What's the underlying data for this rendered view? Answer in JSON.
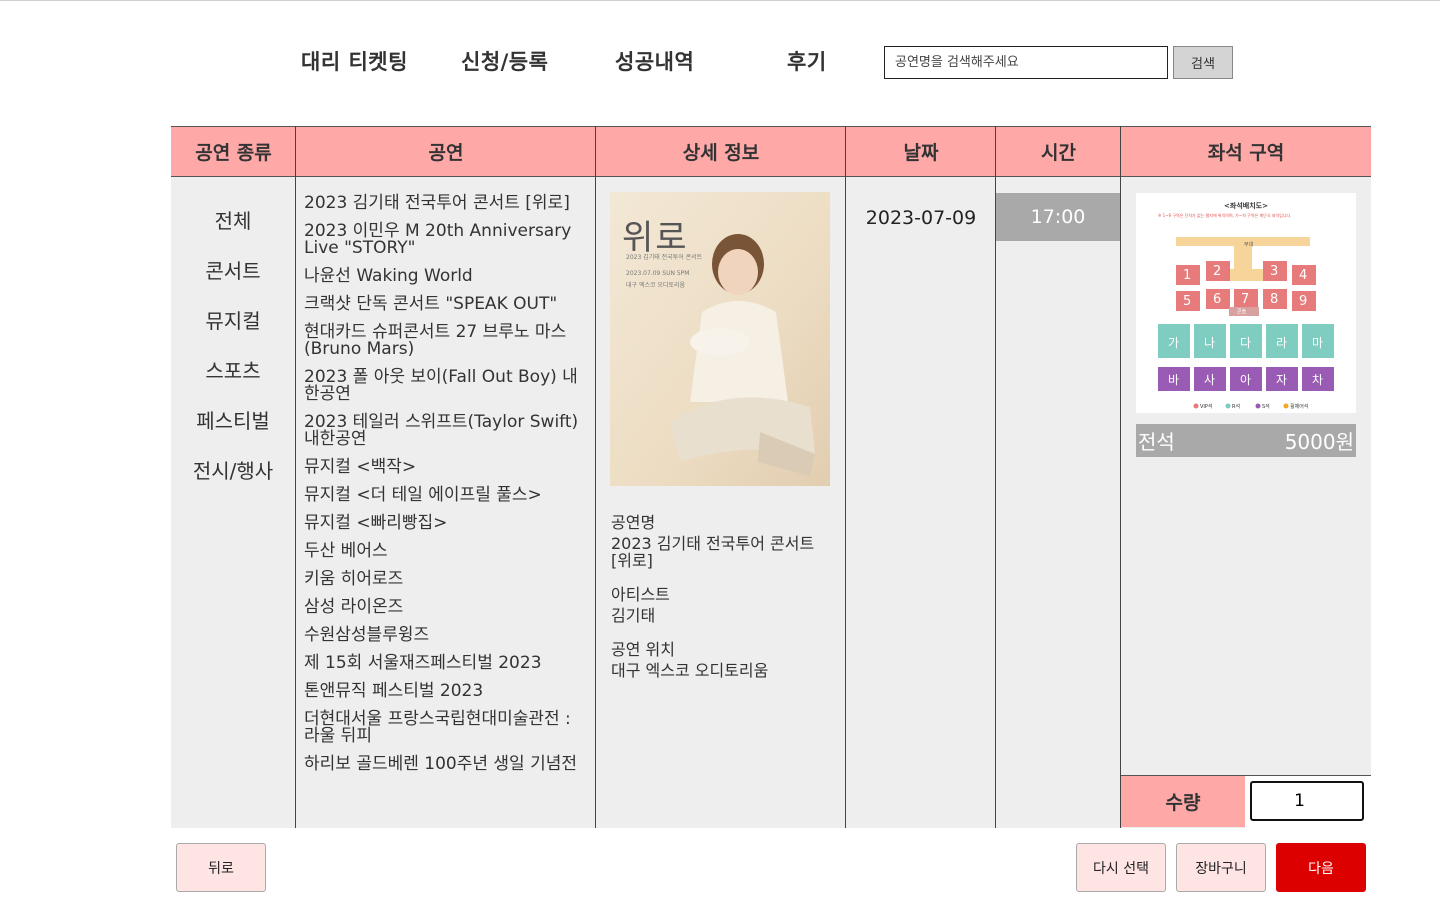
{
  "nav": {
    "items": [
      "대리 티켓팅",
      "신청/등록",
      "성공내역",
      "후기"
    ],
    "search_placeholder": "공연명을 검색해주세요",
    "search_button": "검색"
  },
  "table": {
    "headers": [
      "공연 종류",
      "공연",
      "상세 정보",
      "날짜",
      "시간",
      "좌석 구역"
    ]
  },
  "categories": [
    "전체",
    "콘서트",
    "뮤지컬",
    "스포츠",
    "페스티벌",
    "전시/행사"
  ],
  "shows": [
    "2023 김기태 전국투어 콘서트 [위로]",
    "2023 이민우 M 20th Anniversary Live \"STORY\"",
    "나윤선 Waking World",
    "크랙샷 단독 콘서트 \"SPEAK OUT\"",
    "현대카드 슈퍼콘서트 27 브루노 마스(Bruno Mars)",
    "2023 폴 아웃 보이(Fall Out Boy) 내한공연",
    "2023 테일러 스위프트(Taylor Swift) 내한공연",
    "뮤지컬 <백작>",
    "뮤지컬 <더 테일 에이프릴 풀스>",
    "뮤지컬 <빠리빵집>",
    "두산 베어스",
    "키움 히어로즈",
    "삼성 라이온즈",
    "수원삼성블루윙즈",
    "제 15회 서울재즈페스티벌 2023",
    "톤앤뮤직 페스티벌 2023",
    "더현대서울 프랑스국립현대미술관전 : 라울 뒤피",
    "하리보 골드베렌 100주년 생일 기념전"
  ],
  "detail": {
    "poster_title": "위로",
    "poster_sub": "2023 김기태 전국투어 콘서트",
    "poster_date": "2023.07.09 SUN 5PM",
    "poster_venue": "대구 엑스코 오디토리움",
    "name_label": "공연명",
    "name_value": "2023 김기태 전국투어 콘서트 [위로]",
    "artist_label": "아티스트",
    "artist_value": "김기태",
    "venue_label": "공연 위치",
    "venue_value": "대구 엑스코 오디토리움"
  },
  "date": "2023-07-09",
  "time": "17:00",
  "seat": {
    "map_title": "<좌석배치도>",
    "map_note": "※ 1~9 구역은 단차가 없는 평지에 위치하며, 가~차 구역은 계단식 좌석입니다.",
    "stage": "무대",
    "console": "콘솔",
    "floor_blocks": [
      "1",
      "2",
      "3",
      "4",
      "5",
      "6",
      "7",
      "8",
      "9"
    ],
    "row_a": [
      "가",
      "나",
      "다",
      "라",
      "마"
    ],
    "row_b": [
      "바",
      "사",
      "아",
      "자",
      "차"
    ],
    "legend": [
      "VIP석",
      "R석",
      "S석",
      "휠체어석"
    ],
    "zone": "전석",
    "price": "5000원"
  },
  "quantity": {
    "label": "수량",
    "value": "1"
  },
  "buttons": {
    "back": "뒤로",
    "reset": "다시 선택",
    "cart": "장바구니",
    "next": "다음"
  },
  "colors": {
    "header_pink": "#ffa8a8",
    "next_red": "#dd0000",
    "time_gray": "#a9a9a9",
    "vip": "#e77b7b",
    "r_seat": "#7ecdc0",
    "s_seat": "#9a5bb5",
    "wheel": "#f5a623"
  }
}
